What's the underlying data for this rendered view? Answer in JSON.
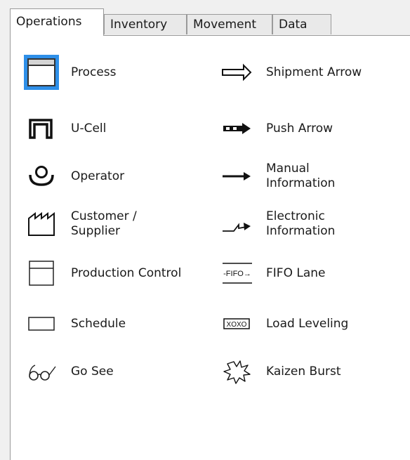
{
  "tabs": [
    {
      "label": "Operations"
    },
    {
      "label": "Inventory"
    },
    {
      "label": "Movement"
    },
    {
      "label": "Data"
    }
  ],
  "active_tab": "Operations",
  "selected_item": "Process",
  "accent_color": "#2e8fe8",
  "left_column": [
    {
      "label": "Process",
      "icon": "process-icon"
    },
    {
      "label": "U-Cell",
      "icon": "u-cell-icon"
    },
    {
      "label": "Operator",
      "icon": "operator-icon"
    },
    {
      "label": "Customer /\nSupplier",
      "icon": "factory-icon"
    },
    {
      "label": "Production Control",
      "icon": "production-control-icon"
    },
    {
      "label": "Schedule",
      "icon": "schedule-icon"
    },
    {
      "label": "Go See",
      "icon": "eyeglasses-icon"
    }
  ],
  "right_column": [
    {
      "label": "Shipment Arrow",
      "icon": "shipment-arrow-icon"
    },
    {
      "label": "Push Arrow",
      "icon": "push-arrow-icon"
    },
    {
      "label": "Manual\nInformation",
      "icon": "manual-arrow-icon"
    },
    {
      "label": "Electronic\nInformation",
      "icon": "electronic-arrow-icon"
    },
    {
      "label": "FIFO Lane",
      "icon": "fifo-lane-icon",
      "icon_text": "-FIFO→"
    },
    {
      "label": "Load Leveling",
      "icon": "load-leveling-icon",
      "icon_text": "XOXO"
    },
    {
      "label": "Kaizen Burst",
      "icon": "kaizen-burst-icon"
    }
  ]
}
